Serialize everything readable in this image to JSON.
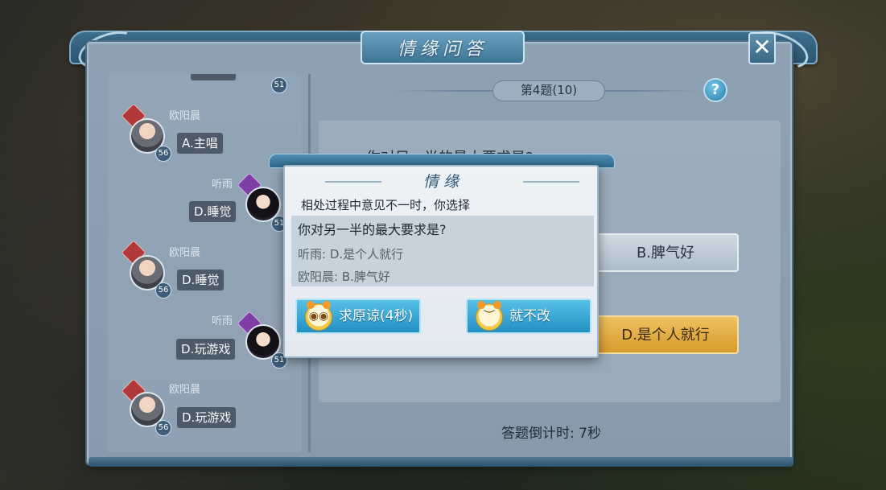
{
  "window": {
    "title": "情缘问答",
    "close_glyph": "✕"
  },
  "question_header": {
    "label": "第4题(10)",
    "help_glyph": "?"
  },
  "chat": [
    {
      "name": "欧阳晨",
      "answer": "A.主唱",
      "level": "56",
      "side": "left"
    },
    {
      "name": "听雨",
      "answer": "D.睡觉",
      "level": "51",
      "side": "right"
    },
    {
      "name": "欧阳晨",
      "answer": "D.睡觉",
      "level": "56",
      "side": "left"
    },
    {
      "name": "听雨",
      "answer": "D.玩游戏",
      "level": "51",
      "side": "right"
    },
    {
      "name": "欧阳晨",
      "answer": "D.玩游戏",
      "level": "56",
      "side": "left"
    }
  ],
  "chat_top_partial_level": "51",
  "answers": {
    "question": "你对另一半的最大要求是?",
    "option_b": "B.脾气好",
    "option_d": "D.是个人就行"
  },
  "countdown": "答题倒计时: 7秒",
  "popup": {
    "title": "情缘",
    "subtitle": "相处过程中意见不一时，你选择",
    "question": "你对另一半的最大要求是?",
    "answer_1": "听雨: D.是个人就行",
    "answer_2": "欧阳晨: B.脾气好",
    "beg_button": "求原谅(4秒)",
    "refuse_button": "就不改"
  },
  "colors": {
    "frame": "#2a5671",
    "gold_option": "#d69b2d",
    "popup_button": "#2390c3"
  }
}
